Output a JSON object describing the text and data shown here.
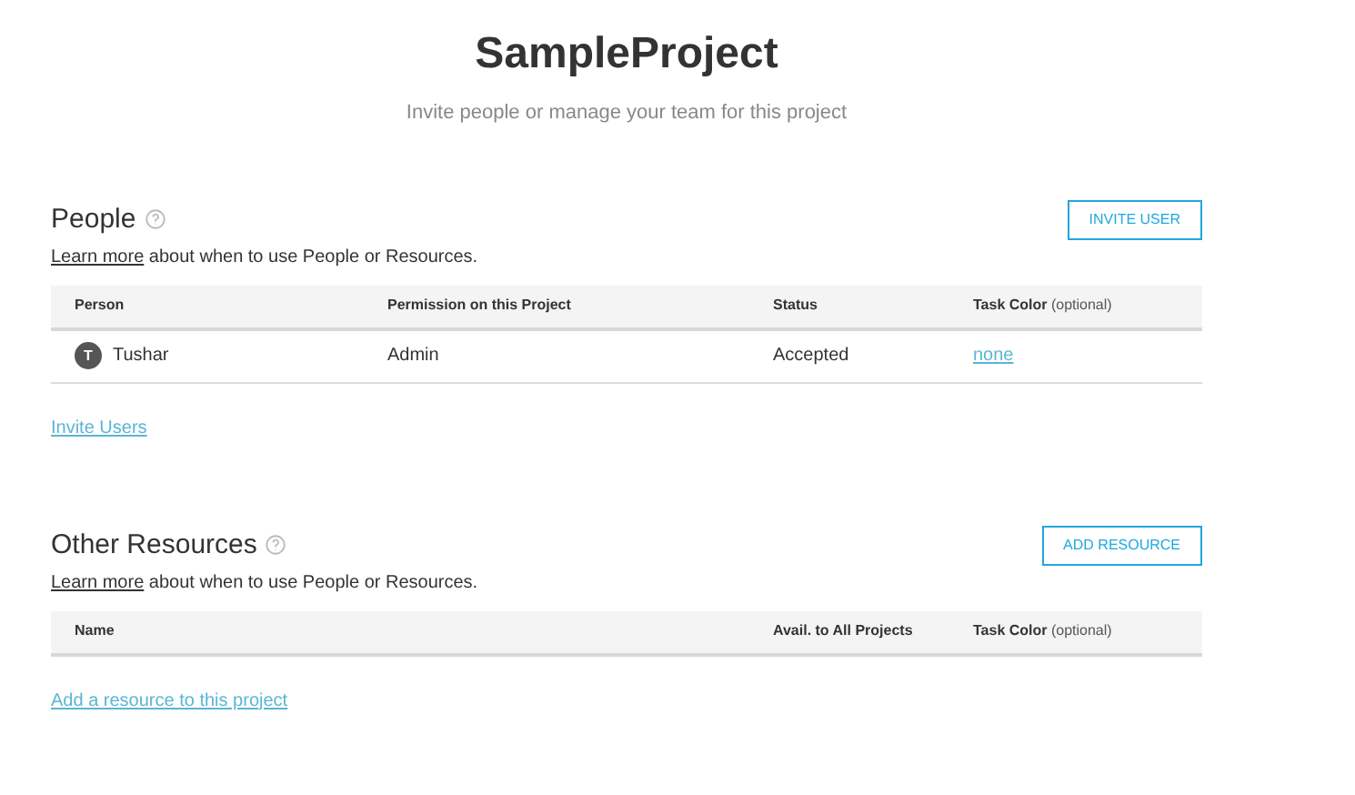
{
  "title": "SampleProject",
  "subtitle": "Invite people or manage your team for this project",
  "sections": [
    {
      "heading": "People",
      "learn_link": "Learn more",
      "learn_text": "about when to use People or Resources.",
      "button": "INVITE USER",
      "columns": [
        {
          "label": "Person"
        },
        {
          "label": "Permission on this Project"
        },
        {
          "label": "Status"
        },
        {
          "label": "Task Color",
          "note": "(optional)"
        }
      ],
      "rows": [
        [
          {
            "kind": "person",
            "initial": "T",
            "text": "Tushar"
          },
          {
            "kind": "text",
            "text": "Admin"
          },
          {
            "kind": "text",
            "text": "Accepted"
          },
          {
            "kind": "link",
            "text": "none"
          }
        ]
      ],
      "footer_link": "Invite Users"
    },
    {
      "heading": "Other Resources",
      "learn_link": "Learn more",
      "learn_text": "about when to use People or Resources.",
      "button": "ADD RESOURCE",
      "columns": [
        {
          "label": "Name"
        },
        {
          "label": "Avail. to All Projects"
        },
        {
          "label": "Task Color",
          "note": "(optional)"
        }
      ],
      "footer_link": "Add a resource to this project"
    }
  ]
}
